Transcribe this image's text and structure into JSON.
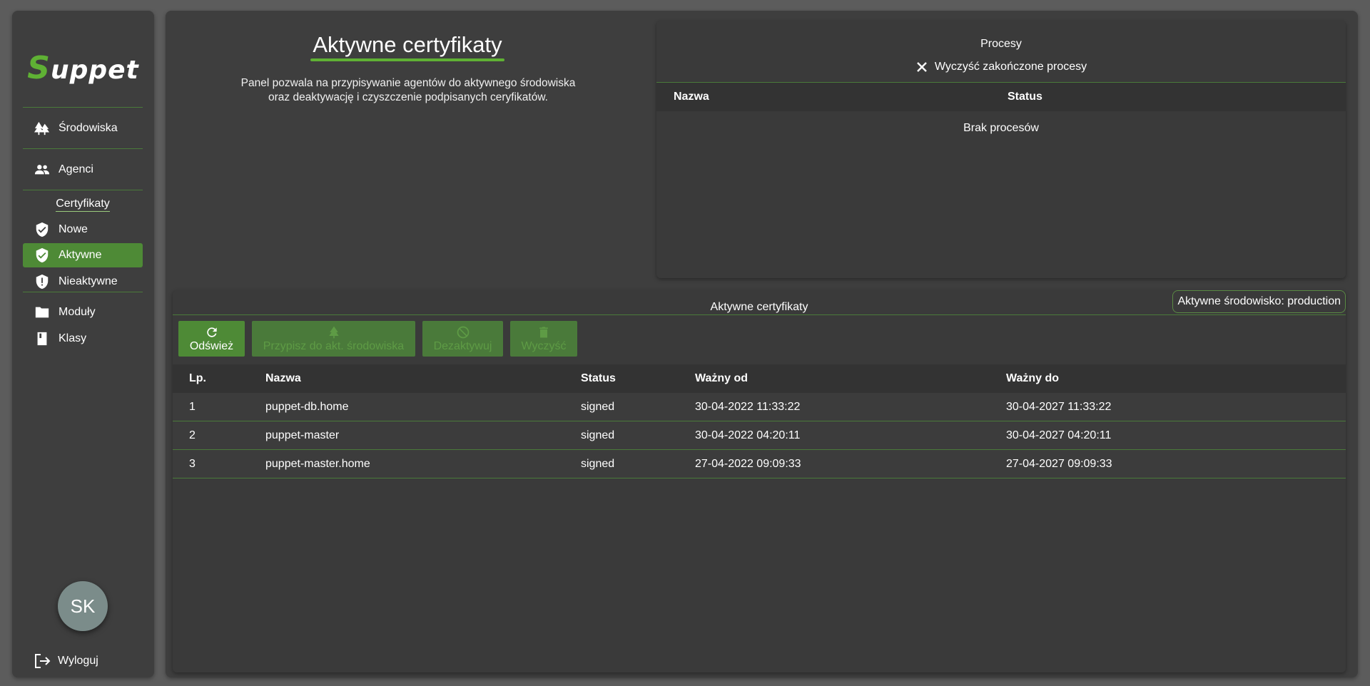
{
  "sidebar": {
    "logo_initial": "S",
    "logo_rest": "uppet",
    "nav": {
      "environments": {
        "label": "Środowiska",
        "icon": "trees-icon"
      },
      "agents": {
        "label": "Agenci",
        "icon": "people-icon"
      },
      "certs_section": "Certyfikaty",
      "new": {
        "label": "Nowe",
        "icon": "shield-check-icon"
      },
      "active": {
        "label": "Aktywne",
        "icon": "shield-check-icon"
      },
      "inactive": {
        "label": "Nieaktywne",
        "icon": "shield-alert-icon"
      },
      "modules": {
        "label": "Moduły",
        "icon": "folder-icon"
      },
      "classes": {
        "label": "Klasy",
        "icon": "book-icon"
      }
    },
    "avatar_initials": "SK",
    "logout_label": "Wyloguj"
  },
  "header": {
    "title": "Aktywne certyfikaty",
    "description_line1": "Panel pozwala na przypisywanie agentów do aktywnego środowiska",
    "description_line2": "oraz deaktywację i czyszczenie podpisanych ceryfikatów."
  },
  "processes": {
    "title": "Procesy",
    "clear_label": "Wyczyść zakończone procesy",
    "columns": [
      "Nazwa",
      "Status"
    ],
    "empty_text": "Brak procesów"
  },
  "certificates": {
    "panel_title": "Aktywne certyfikaty",
    "active_env_label": "Aktywne środowisko: production",
    "buttons": {
      "refresh": "Odśwież",
      "assign": "Przypisz do akt. środowiska",
      "deactivate": "Dezaktywuj",
      "clean": "Wyczyść"
    },
    "columns": [
      "Lp.",
      "Nazwa",
      "Status",
      "Ważny od",
      "Ważny do"
    ],
    "rows": [
      [
        "1",
        "puppet-db.home",
        "signed",
        "30-04-2022 11:33:22",
        "30-04-2027 11:33:22"
      ],
      [
        "2",
        "puppet-master",
        "signed",
        "30-04-2022 04:20:11",
        "30-04-2027 04:20:11"
      ],
      [
        "3",
        "puppet-master.home",
        "signed",
        "27-04-2022 09:09:33",
        "27-04-2027 09:09:33"
      ]
    ]
  },
  "colors": {
    "accent": "#5fb134",
    "active_bg": "#4e8a36",
    "panel_bg": "#3e3e3e",
    "page_bg": "#5c5c5c"
  }
}
